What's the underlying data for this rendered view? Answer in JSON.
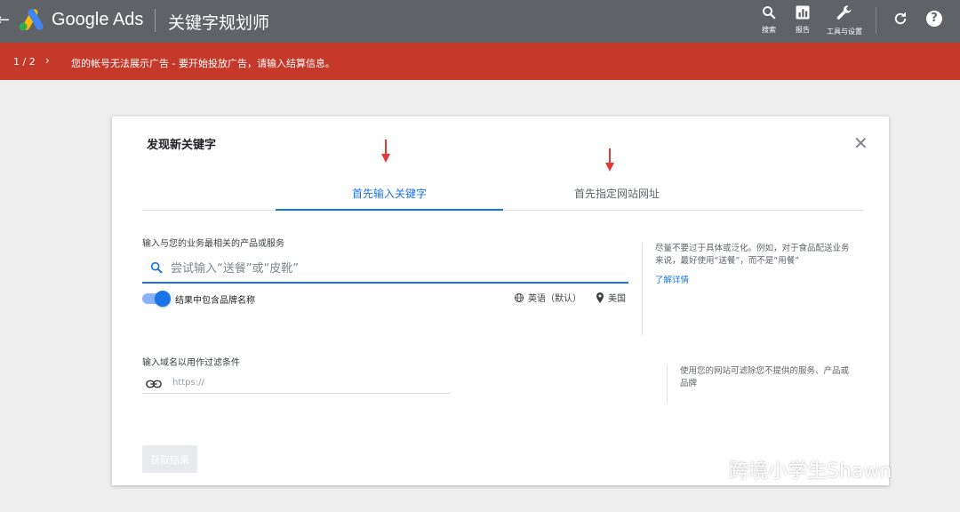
{
  "topbar": {
    "back_glyph": "←",
    "brand": "Google Ads",
    "product": "关键字规划师",
    "tools": [
      {
        "label": "搜索",
        "icon": "search-icon"
      },
      {
        "label": "报告",
        "icon": "reports-icon"
      },
      {
        "label": "工具与设置",
        "icon": "wrench-icon"
      }
    ],
    "help_glyph": "?"
  },
  "alert": {
    "count": "1 / 2",
    "chevron": "›",
    "message": "您的帐号无法展示广告 - 要开始投放广告，请输入结算信息。"
  },
  "dialog": {
    "title": "发现新关键字",
    "close_glyph": "✕",
    "tabs": [
      {
        "label": "首先输入关键字",
        "active": true
      },
      {
        "label": "首先指定网站网址",
        "active": false
      }
    ],
    "keyword_section": {
      "label": "输入与您的业务最相关的产品或服务",
      "placeholder": "尝试输入“送餐”或“皮靴”",
      "toggle_label": "结果中包含品牌名称",
      "toggle_on": true,
      "language": "英语（默认）",
      "location": "美国",
      "tip": "尽量不要过于具体或泛化。例如，对于食品配送业务来说，最好使用“送餐”，而不是“用餐”",
      "learn_more": "了解详情"
    },
    "domain_section": {
      "label": "输入域名以用作过滤条件",
      "placeholder": "https://",
      "tip": "使用您的网站可滤除您不提供的服务、产品或品牌"
    },
    "submit_label": "获取结果"
  },
  "watermark": {
    "text": "跨境小学生Shawn"
  },
  "colors": {
    "topbar": "#5f6368",
    "alert": "#c5392b",
    "accent": "#1a73e8",
    "annotation_arrow": "#e53935"
  }
}
